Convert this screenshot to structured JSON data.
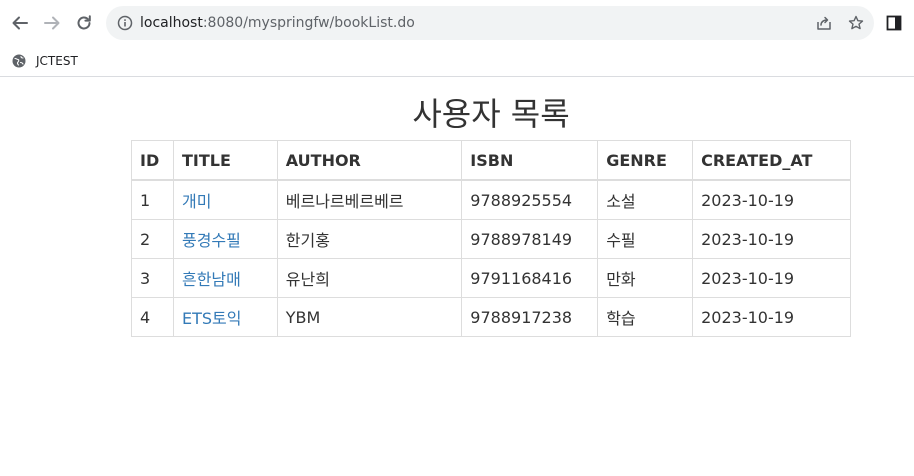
{
  "browser": {
    "url_host": "localhost",
    "url_rest": ":8080/myspringfw/bookList.do",
    "icons": {
      "back": "arrow-left-icon",
      "forward": "arrow-right-icon",
      "reload": "reload-icon",
      "site_info": "info-icon",
      "share": "share-icon",
      "bookmark_star": "star-icon",
      "side_panel": "side-panel-icon"
    }
  },
  "bookmarks_bar": {
    "items": [
      {
        "label": "JCTEST",
        "icon": "globe-icon"
      }
    ]
  },
  "page": {
    "title": "사용자 목록",
    "table": {
      "headers": [
        "ID",
        "TITLE",
        "AUTHOR",
        "ISBN",
        "GENRE",
        "CREATED_AT"
      ],
      "rows": [
        {
          "id": "1",
          "title": "개미",
          "author": "베르나르베르베르",
          "isbn": "9788925554",
          "genre": "소설",
          "created_at": "2023-10-19"
        },
        {
          "id": "2",
          "title": "풍경수필",
          "author": "한기홍",
          "isbn": "9788978149",
          "genre": "수필",
          "created_at": "2023-10-19"
        },
        {
          "id": "3",
          "title": "흔한남매",
          "author": "유난희",
          "isbn": "9791168416",
          "genre": "만화",
          "created_at": "2023-10-19"
        },
        {
          "id": "4",
          "title": "ETS토익",
          "author": "YBM",
          "isbn": "9788917238",
          "genre": "학습",
          "created_at": "2023-10-19"
        }
      ]
    },
    "colors": {
      "link": "#337ab7",
      "text": "#333333",
      "border": "#dddddd"
    }
  }
}
